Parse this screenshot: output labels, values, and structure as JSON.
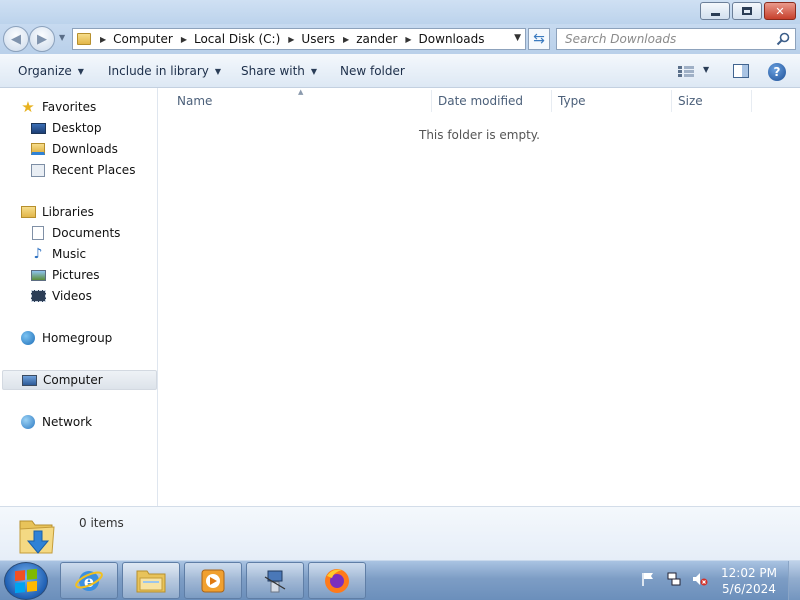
{
  "window": {
    "controls": {
      "minimize": "minimize",
      "maximize": "maximize",
      "close": "close"
    }
  },
  "address": {
    "breadcrumbs": [
      "Computer",
      "Local Disk (C:)",
      "Users",
      "zander",
      "Downloads"
    ]
  },
  "search": {
    "placeholder": "Search Downloads"
  },
  "toolbar": {
    "organize": "Organize",
    "include_in_library": "Include in library",
    "share_with": "Share with",
    "new_folder": "New folder"
  },
  "sidebar": {
    "favorites": {
      "label": "Favorites",
      "items": [
        "Desktop",
        "Downloads",
        "Recent Places"
      ]
    },
    "libraries": {
      "label": "Libraries",
      "items": [
        "Documents",
        "Music",
        "Pictures",
        "Videos"
      ]
    },
    "homegroup": "Homegroup",
    "computer": "Computer",
    "network": "Network"
  },
  "columns": [
    "Name",
    "Date modified",
    "Type",
    "Size"
  ],
  "content": {
    "empty_message": "This folder is empty."
  },
  "details": {
    "item_count": "0 items"
  },
  "taskbar": {
    "items": [
      "start-orb",
      "internet-explorer-icon",
      "windows-explorer-icon",
      "media-player-icon",
      "network-setup-icon",
      "firefox-icon"
    ],
    "tray_icons": [
      "action-center-flag-icon",
      "network-icon",
      "volume-muted-icon"
    ],
    "time": "12:02 PM",
    "date": "5/6/2024"
  },
  "colors": {
    "titlebar": "#c7daf0",
    "toolbar": "#e9f0f8",
    "taskbar": "#7d9dc5",
    "close_button": "#c7402c",
    "accent": "#1d4f96"
  }
}
